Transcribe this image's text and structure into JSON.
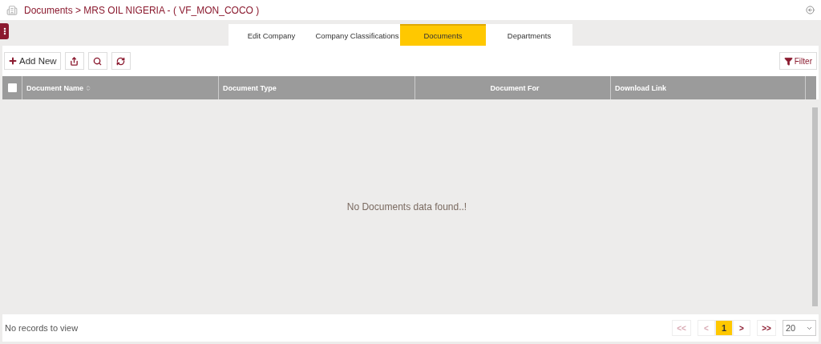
{
  "breadcrumb": "Documents > MRS OIL NIGERIA - ( VF_MON_COCO )",
  "tabs": [
    {
      "label": "Edit Company",
      "selected": false
    },
    {
      "label": "Company Classifications",
      "selected": false
    },
    {
      "label": "Documents",
      "selected": true
    },
    {
      "label": "Departments",
      "selected": false
    }
  ],
  "toolbar": {
    "add_label": "Add New",
    "filter_label": "Filter"
  },
  "table": {
    "columns": [
      {
        "label": "Document Name",
        "sortable": true
      },
      {
        "label": "Document Type",
        "sortable": false
      },
      {
        "label": "Document For",
        "sortable": false
      },
      {
        "label": "Download Link",
        "sortable": false
      }
    ],
    "all_checked": false,
    "empty_message": "No Documents data found..!"
  },
  "footer": {
    "status": "No records to view",
    "pager": [
      {
        "label": "<<",
        "disabled": true,
        "selected": false
      },
      {
        "label": "<",
        "disabled": true,
        "selected": false
      },
      {
        "label": "1",
        "disabled": false,
        "selected": true
      },
      {
        "label": ">",
        "disabled": false,
        "selected": false
      },
      {
        "label": ">>",
        "disabled": false,
        "selected": false
      }
    ],
    "page_size": "20"
  }
}
